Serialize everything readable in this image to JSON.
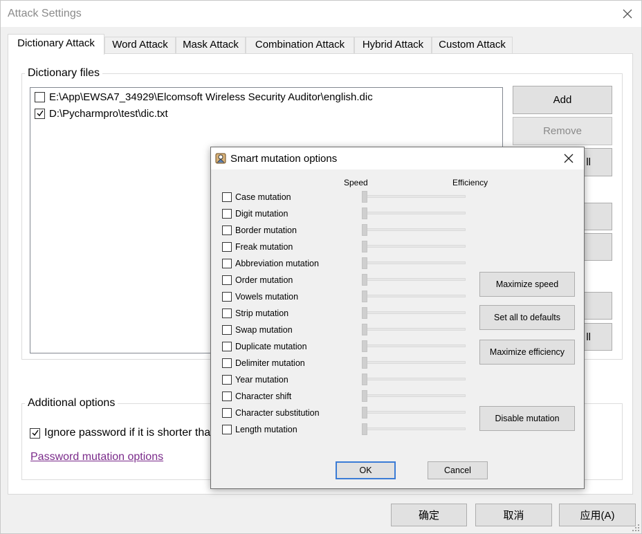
{
  "window": {
    "title": "Attack Settings"
  },
  "tabs": [
    {
      "label": "Dictionary Attack",
      "active": true
    },
    {
      "label": "Word Attack"
    },
    {
      "label": "Mask Attack"
    },
    {
      "label": "Combination Attack"
    },
    {
      "label": "Hybrid Attack"
    },
    {
      "label": "Custom Attack"
    }
  ],
  "dictionary": {
    "group_title": "Dictionary files",
    "files": [
      {
        "path": "E:\\App\\EWSA7_34929\\Elcomsoft Wireless Security Auditor\\english.dic",
        "checked": false
      },
      {
        "path": "D:\\Pycharmpro\\test\\dic.txt",
        "checked": true
      }
    ],
    "add_label": "Add",
    "remove_label": "Remove",
    "partial_label_1": "ll",
    "partial_label_2": "ll"
  },
  "additional": {
    "group_title": "Additional options",
    "ignore_label": "Ignore password if it is shorter tha",
    "ignore_checked": true,
    "link_label": "Password mutation options"
  },
  "footer": {
    "ok_label": "确定",
    "cancel_label": "取消",
    "apply_label": "应用(A)"
  },
  "modal": {
    "title": "Smart mutation options",
    "speed_label": "Speed",
    "efficiency_label": "Efficiency",
    "mutations": [
      {
        "label": "Case mutation",
        "checked": false,
        "level": 0
      },
      {
        "label": "Digit mutation",
        "checked": false,
        "level": 0
      },
      {
        "label": "Border mutation",
        "checked": false,
        "level": 0
      },
      {
        "label": "Freak mutation",
        "checked": false,
        "level": 0
      },
      {
        "label": "Abbreviation mutation",
        "checked": false,
        "level": 0
      },
      {
        "label": "Order mutation",
        "checked": false,
        "level": 0
      },
      {
        "label": "Vowels mutation",
        "checked": false,
        "level": 0
      },
      {
        "label": "Strip mutation",
        "checked": false,
        "level": 0
      },
      {
        "label": "Swap mutation",
        "checked": false,
        "level": 0
      },
      {
        "label": "Duplicate mutation",
        "checked": false,
        "level": 0
      },
      {
        "label": "Delimiter mutation",
        "checked": false,
        "level": 0
      },
      {
        "label": "Year mutation",
        "checked": false,
        "level": 0
      },
      {
        "label": "Character shift",
        "checked": false,
        "level": 0
      },
      {
        "label": "Character substitution",
        "checked": false,
        "level": 0
      },
      {
        "label": "Length mutation",
        "checked": false,
        "level": 0
      }
    ],
    "maximize_speed_label": "Maximize speed",
    "defaults_label": "Set all to defaults",
    "maximize_efficiency_label": "Maximize efficiency",
    "disable_label": "Disable mutation",
    "ok_label": "OK",
    "cancel_label": "Cancel"
  },
  "colors": {
    "link": "#7a2a8a",
    "default_button_border": "#3a7bd5"
  }
}
